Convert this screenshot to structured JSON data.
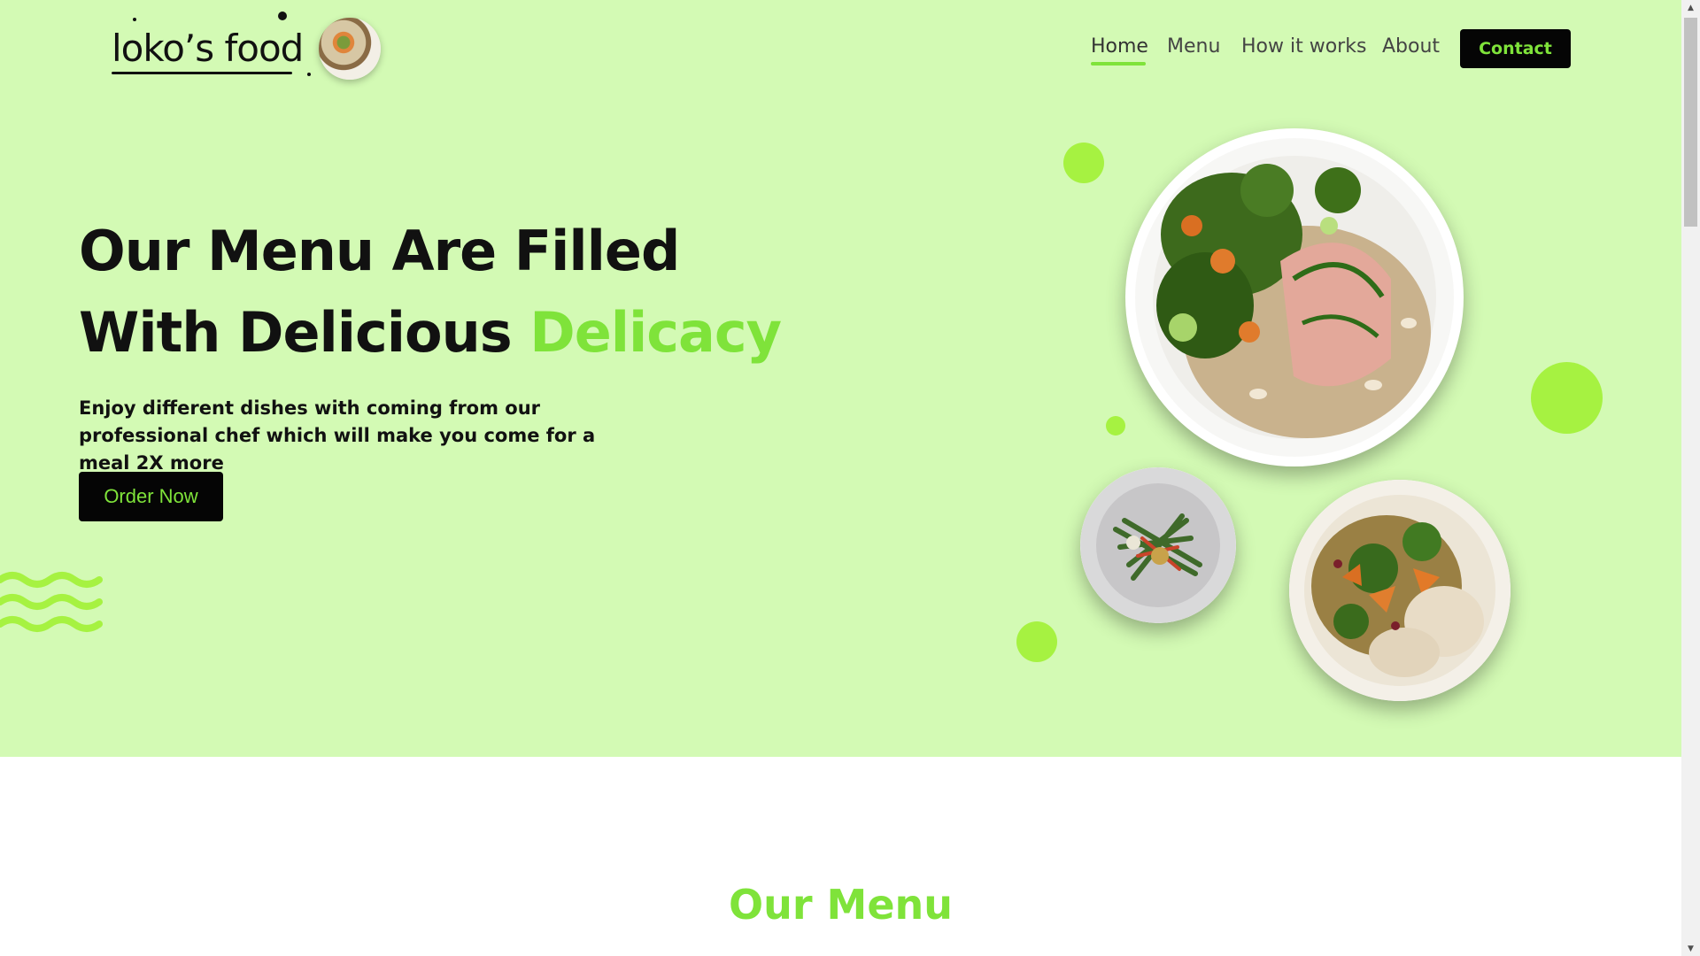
{
  "brand": {
    "name": "loko’s food"
  },
  "nav": {
    "items": [
      "Home",
      "Menu",
      "How it works",
      "About"
    ],
    "active": "Home",
    "contact_label": "Contact"
  },
  "hero": {
    "headline_line1": "Our Menu Are Filled",
    "headline_line2_prefix": "With Delicious ",
    "headline_accent": "Delicacy",
    "subtext": "Enjoy different dishes with coming from our professional chef which will make you come for a meal 2X more",
    "cta_label": "Order Now"
  },
  "menu_section": {
    "title": "Our Menu"
  },
  "colors": {
    "hero_background": "#d3fab4",
    "accent_green": "#7fe33a",
    "bubble_green": "#a6f241",
    "button_black": "#050505"
  },
  "icons": {
    "waves": "wave-decoration-icon",
    "scroll_up": "scroll-up-arrow-icon",
    "scroll_down": "scroll-down-arrow-icon"
  }
}
